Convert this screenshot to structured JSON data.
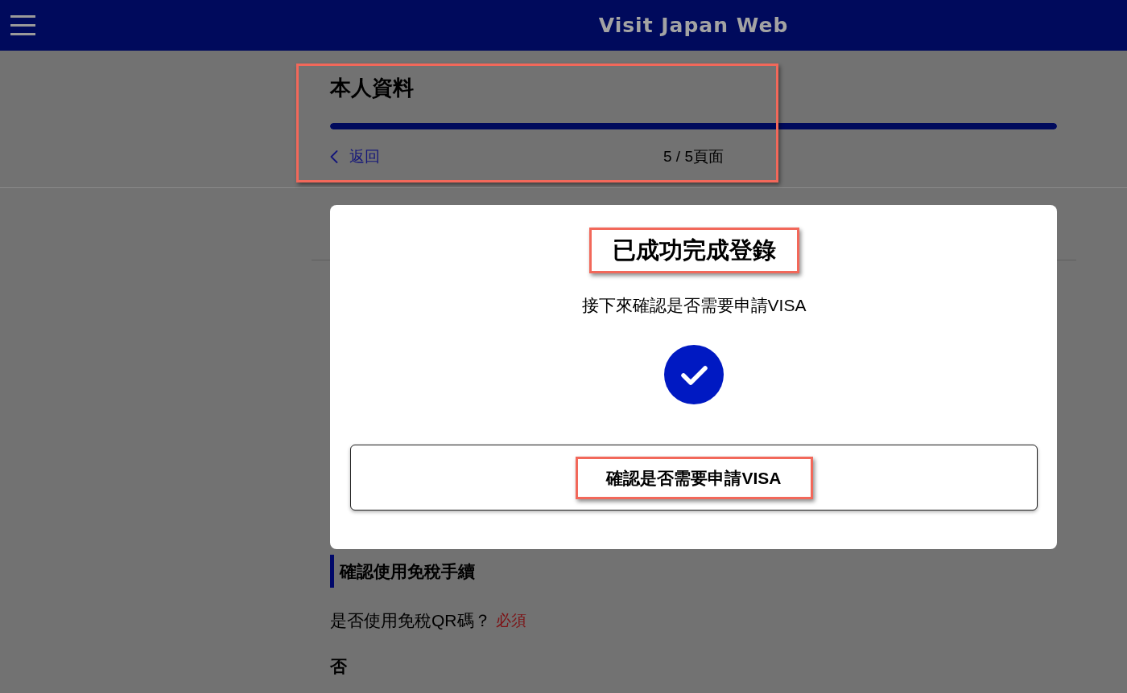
{
  "header": {
    "title": "Visit Japan Web"
  },
  "page_header": {
    "title": "本人資料",
    "progress": {
      "level": 1
    },
    "back_link": "返回",
    "page_count": "5 / 5頁面",
    "highlighted": true
  },
  "modal": {
    "title": {
      "text": "已成功完成登錄",
      "highlighted": true
    },
    "message": "接下來確認是否需要申請VISA",
    "button": {
      "label": "確認是否需要申請VISA",
      "highlighted": true
    }
  },
  "section": {
    "heading": "確認使用免稅手續",
    "question": "是否使用免稅QR碼？",
    "required_tag": "必須",
    "answer": "否"
  }
}
